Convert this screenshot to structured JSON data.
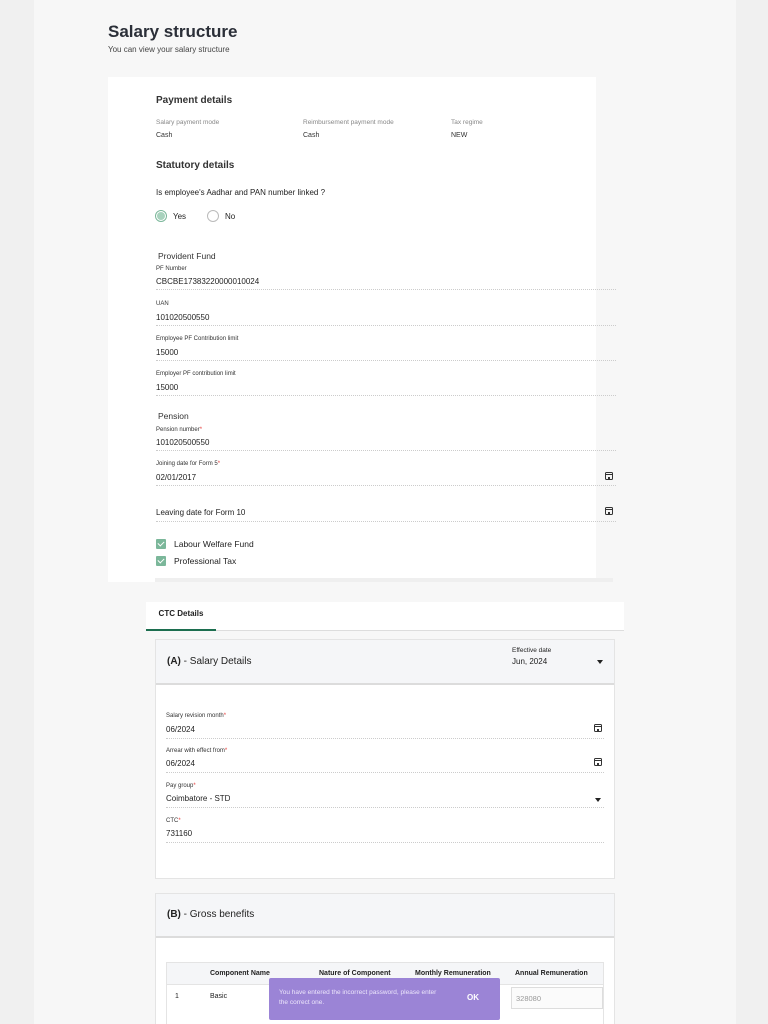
{
  "header": {
    "title": "Salary structure",
    "subtitle": "You can view your salary structure"
  },
  "payment": {
    "title": "Payment details",
    "salary_mode_label": "Salary payment mode",
    "salary_mode_value": "Cash",
    "reimb_mode_label": "Reimbursement payment mode",
    "reimb_mode_value": "Cash",
    "tax_label": "Tax regime",
    "tax_value": "NEW"
  },
  "statutory": {
    "title": "Statutory details",
    "question": "Is employee's Aadhar and PAN number linked ?",
    "yes_label": "Yes",
    "no_label": "No",
    "selected": "Yes"
  },
  "provident_fund": {
    "title": "Provident Fund",
    "pf_number_label": "PF Number",
    "pf_number_value": "CBCBE17383220000010024",
    "uan_label": "UAN",
    "uan_value": "101020500550",
    "emp_contrib_label": "Employee PF Contribution limit",
    "emp_contrib_value": "15000",
    "employer_contrib_label": "Employer PF contribution limit",
    "employer_contrib_value": "15000"
  },
  "pension": {
    "title": "Pension",
    "pension_number_label": "Pension number",
    "pension_number_value": "101020500550",
    "joining_label": "Joining date for Form 5",
    "joining_value": "02/01/2017",
    "leaving_label": "Leaving date for Form 10"
  },
  "checkboxes": {
    "lwf_label": "Labour Welfare Fund",
    "pt_label": "Professional Tax"
  },
  "tabs": {
    "ctc_label": "CTC Details"
  },
  "salary_details": {
    "prefix": "(A)",
    "title": " - Salary Details",
    "effective_label": "Effective date",
    "effective_value": "Jun, 2024",
    "revision_label": "Salary revision month",
    "revision_value": "06/2024",
    "arrear_label": "Arrear with effect from",
    "arrear_value": "06/2024",
    "paygroup_label": "Pay group",
    "paygroup_value": "Coimbatore - STD",
    "ctc_label": "CTC",
    "ctc_value": "731160"
  },
  "gross_benefits": {
    "prefix": "(B)",
    "title": " - Gross benefits",
    "columns": [
      "Component Name",
      "Nature of Component",
      "Monthly Remuneration",
      "Annual Remuneration"
    ],
    "rows": [
      {
        "index": "1",
        "name": "Basic",
        "annual": "328080"
      }
    ]
  },
  "toast": {
    "message": "You have entered the incorrect password, please enter the correct one.",
    "ok_label": "OK"
  },
  "colors": {
    "accent_green": "#1c6e4f",
    "check_green": "#7bb79a",
    "toast_purple": "#9b84d6",
    "required_red": "#e53935"
  }
}
